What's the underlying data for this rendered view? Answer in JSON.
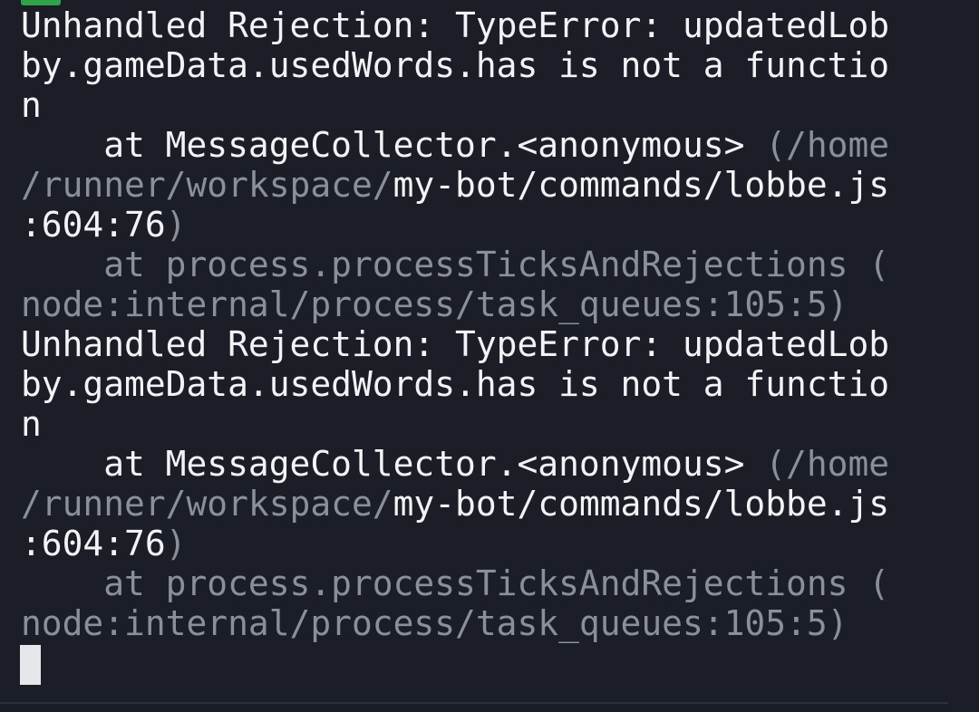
{
  "terminal": {
    "lines": [
      [
        {
          "t": "Unhandled Rejection: TypeError: updatedLob",
          "c": "bright"
        }
      ],
      [
        {
          "t": "by.gameData.usedWords.has is not a functio",
          "c": "bright"
        }
      ],
      [
        {
          "t": "n",
          "c": "bright"
        }
      ],
      [
        {
          "t": "    at MessageCollector.<anonymous> ",
          "c": "bright"
        },
        {
          "t": "(/home",
          "c": "dim"
        }
      ],
      [
        {
          "t": "/runner/workspace/",
          "c": "dim"
        },
        {
          "t": "my-bot/commands/lobbe.js",
          "c": "bright"
        }
      ],
      [
        {
          "t": ":604:76",
          "c": "bright"
        },
        {
          "t": ")",
          "c": "dim"
        }
      ],
      [
        {
          "t": "    at process.processTicksAndRejections (",
          "c": "dim"
        }
      ],
      [
        {
          "t": "node:internal/process/task_queues:105:5)",
          "c": "dim"
        }
      ],
      [
        {
          "t": "Unhandled Rejection: TypeError: updatedLob",
          "c": "bright"
        }
      ],
      [
        {
          "t": "by.gameData.usedWords.has is not a functio",
          "c": "bright"
        }
      ],
      [
        {
          "t": "n",
          "c": "bright"
        }
      ],
      [
        {
          "t": "    at MessageCollector.<anonymous> ",
          "c": "bright"
        },
        {
          "t": "(/home",
          "c": "dim"
        }
      ],
      [
        {
          "t": "/runner/workspace/",
          "c": "dim"
        },
        {
          "t": "my-bot/commands/lobbe.js",
          "c": "bright"
        }
      ],
      [
        {
          "t": ":604:76",
          "c": "bright"
        },
        {
          "t": ")",
          "c": "dim"
        }
      ],
      [
        {
          "t": "    at process.processTicksAndRejections (",
          "c": "dim"
        }
      ],
      [
        {
          "t": "node:internal/process/task_queues:105:5)",
          "c": "dim"
        }
      ]
    ]
  },
  "colors": {
    "background": "#1b1e26",
    "text_bright": "#f2f3f5",
    "text_dim": "#8a8f99",
    "cursor": "#e6e7ea"
  },
  "icons": {
    "top_partial": "check-badge-icon"
  }
}
